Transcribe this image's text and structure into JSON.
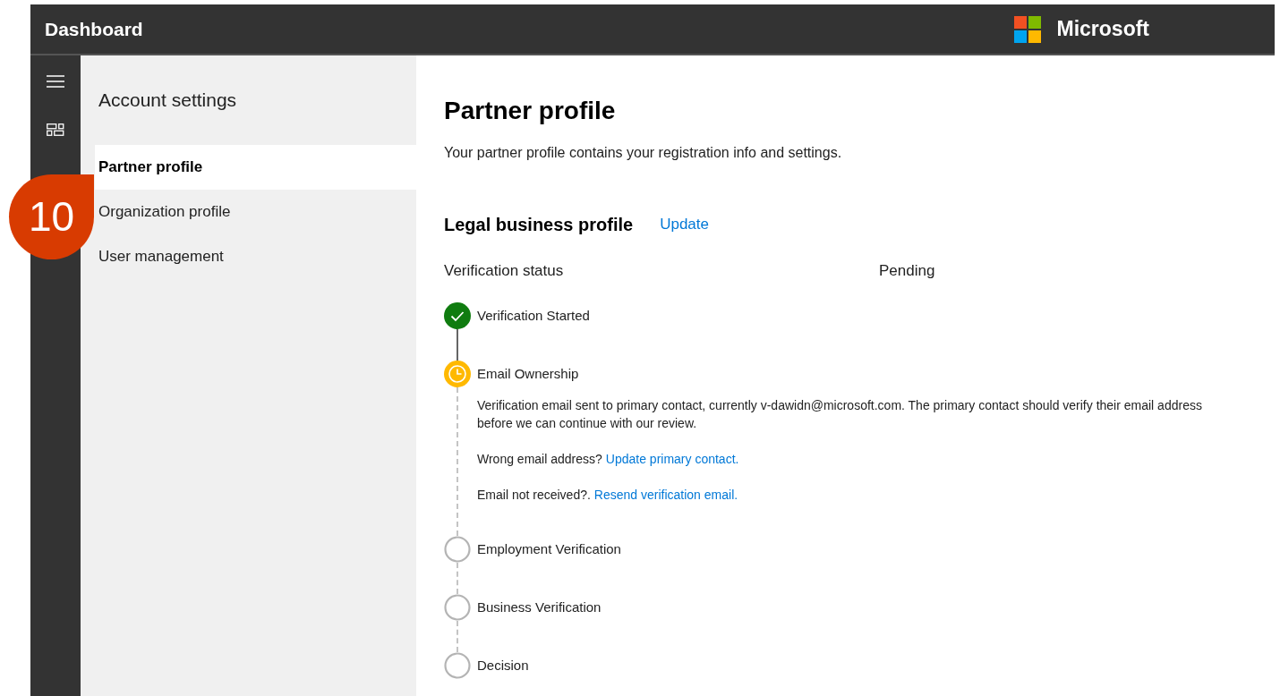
{
  "top_bar": {
    "title": "Dashboard",
    "brand": "Microsoft"
  },
  "sidebar": {
    "title": "Account settings",
    "items": [
      {
        "label": "Partner profile",
        "selected": true
      },
      {
        "label": "Organization profile",
        "selected": false
      },
      {
        "label": "User management",
        "selected": false
      }
    ]
  },
  "callout": {
    "number": "10"
  },
  "main": {
    "title": "Partner profile",
    "description": "Your partner profile contains your registration info and settings.",
    "section": {
      "title": "Legal business profile",
      "action": "Update"
    },
    "status_row": {
      "label": "Verification status",
      "value": "Pending"
    },
    "steps": [
      {
        "label": "Verification Started",
        "done": true,
        "current": false
      },
      {
        "label": "Email Ownership",
        "done": false,
        "current": true,
        "details": {
          "paragraph": "Verification email sent to primary contact, currently v-dawidn@microsoft.com. The primary contact should verify their email address before we can continue with our review.",
          "prompts": [
            {
              "text": "Wrong email address?",
              "link": "Update primary contact."
            },
            {
              "text": "Email not received?.",
              "link": "Resend verification email."
            }
          ]
        }
      },
      {
        "label": "Employment Verification",
        "done": false,
        "current": false
      },
      {
        "label": "Business Verification",
        "done": false,
        "current": false
      },
      {
        "label": "Decision",
        "done": false,
        "current": false
      }
    ]
  }
}
